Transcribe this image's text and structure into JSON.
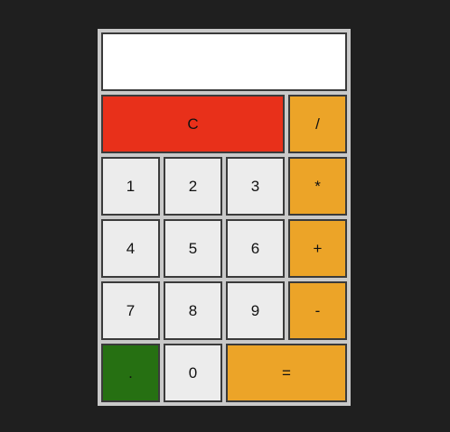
{
  "display": {
    "value": ""
  },
  "keys": {
    "clear": "C",
    "divide": "/",
    "multiply": "*",
    "add": "+",
    "subtract": "-",
    "dot": ".",
    "equals": "=",
    "d0": "0",
    "d1": "1",
    "d2": "2",
    "d3": "3",
    "d4": "4",
    "d5": "5",
    "d6": "6",
    "d7": "7",
    "d8": "8",
    "d9": "9"
  },
  "colors": {
    "background": "#1f1f1f",
    "frame": "#c9c9c9",
    "number_key": "#ececec",
    "operator_key": "#eca428",
    "clear_key": "#e8301a",
    "dot_key": "#267012"
  }
}
